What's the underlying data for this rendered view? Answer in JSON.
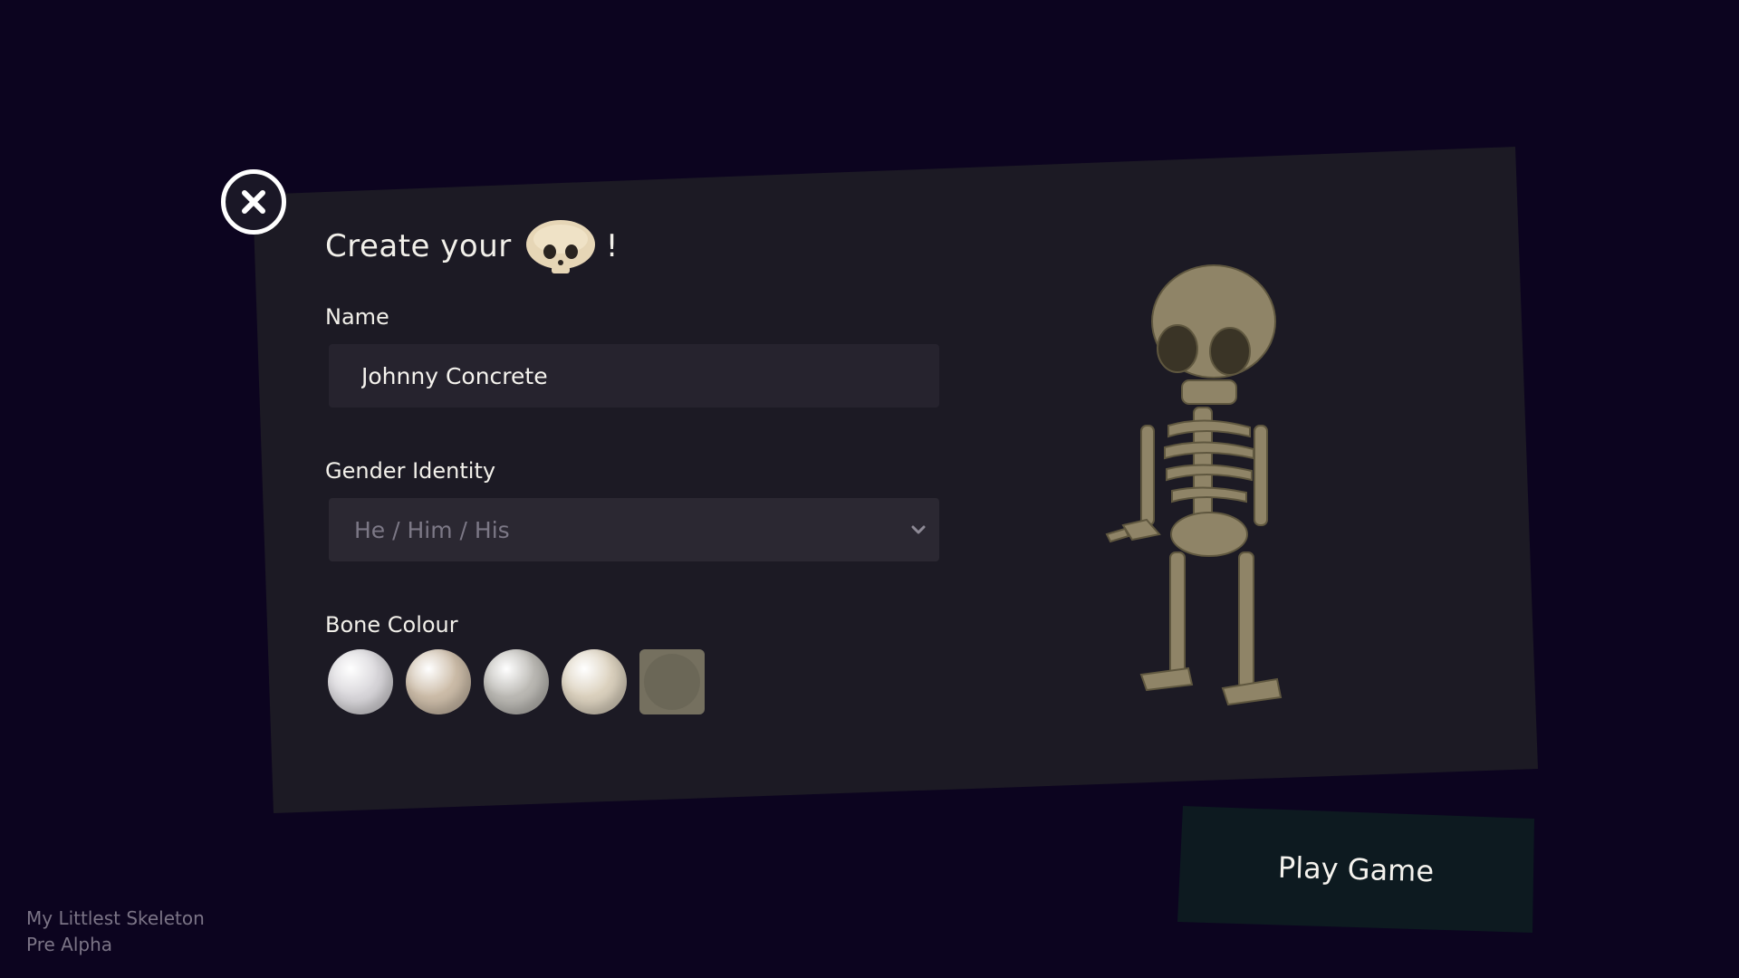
{
  "title": {
    "prefix": "Create your",
    "suffix": "!",
    "icon": "skull-icon"
  },
  "name_field": {
    "label": "Name",
    "value": "Johnny Concrete"
  },
  "gender_field": {
    "label": "Gender Identity",
    "selected": "He / Him / His"
  },
  "bone_colour": {
    "label": "Bone Colour",
    "swatches": [
      {
        "color": "#d9d7db",
        "selected": false
      },
      {
        "color": "#cdbda9",
        "selected": false
      },
      {
        "color": "#bcbab5",
        "selected": false
      },
      {
        "color": "#dcd2bf",
        "selected": false
      },
      {
        "color": "#75705f",
        "selected": true
      }
    ]
  },
  "play_button": {
    "label": "Play Game"
  },
  "footer": {
    "game_name": "My Littlest Skeleton",
    "build": "Pre Alpha"
  },
  "colors": {
    "background": "#0c041f",
    "card": "#1c1a24",
    "play_button": "#0d1a20",
    "bone": "#8f8467"
  }
}
